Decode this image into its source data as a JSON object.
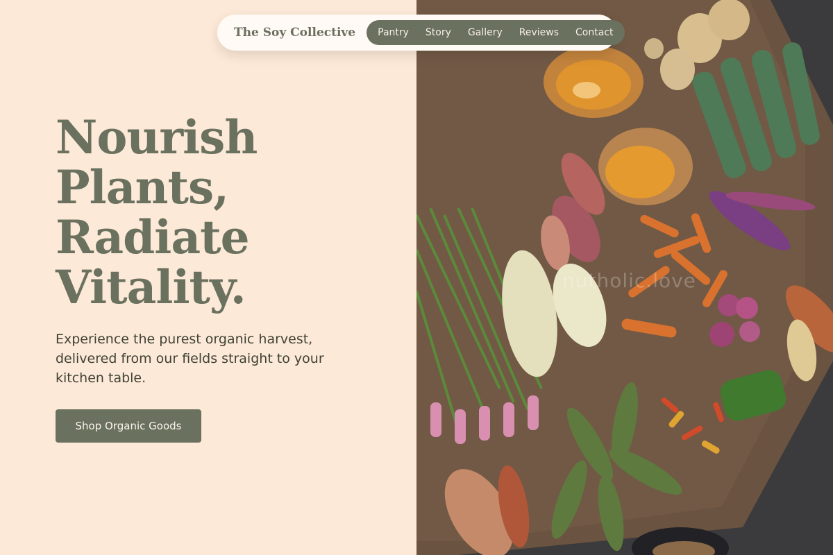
{
  "nav": {
    "brand": "The Soy Collective",
    "links": [
      "Pantry",
      "Story",
      "Gallery",
      "Reviews",
      "Contact"
    ]
  },
  "hero": {
    "headline_lines": [
      "Nourish",
      "Plants,",
      "Radiate",
      "Vitality."
    ],
    "subtitle": "Experience the purest organic harvest, delivered from our fields straight to your kitchen table.",
    "cta_label": "Shop Organic Goods"
  },
  "image": {
    "alt": "Assorted fresh vegetables on burlap: squash, carrots, onions, eggplant, chilies, green onions, plantains",
    "watermark": "nutholic.love"
  },
  "colors": {
    "background": "#fde9d7",
    "accent": "#6b715f",
    "nav_bg": "#fffaf5",
    "text_dark": "#3f4236"
  }
}
